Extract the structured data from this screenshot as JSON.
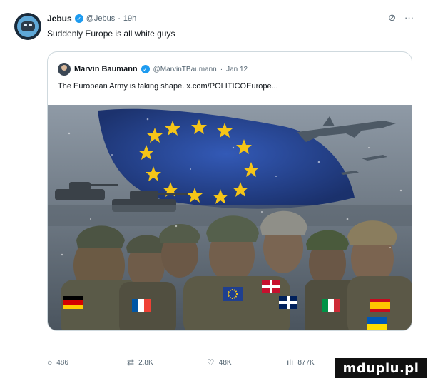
{
  "tweet": {
    "author": "Jebus",
    "handle": "@Jebus",
    "time": "19h",
    "text": "Suddenly Europe is all white guys"
  },
  "quote": {
    "author": "Marvin Baumann",
    "handle": "@MarvinTBaumann",
    "date": "Jan 12",
    "text": "The European Army is taking shape. x.com/POLITICOEurope..."
  },
  "actions": {
    "replies": "486",
    "reposts": "2.8K",
    "likes": "48K",
    "views": "877K"
  },
  "watermark": "mdupiu.pl",
  "icons": {
    "verified": "verified-badge-icon",
    "grok": "grok-icon",
    "more": "more-icon",
    "reply": "reply-icon",
    "repost": "repost-icon",
    "like": "heart-icon",
    "views": "analytics-icon"
  },
  "colors": {
    "verified": "#1d9bf0",
    "secondary_text": "#536471",
    "flag_blue": "#1f3f8f",
    "flag_star": "#f5c518"
  }
}
